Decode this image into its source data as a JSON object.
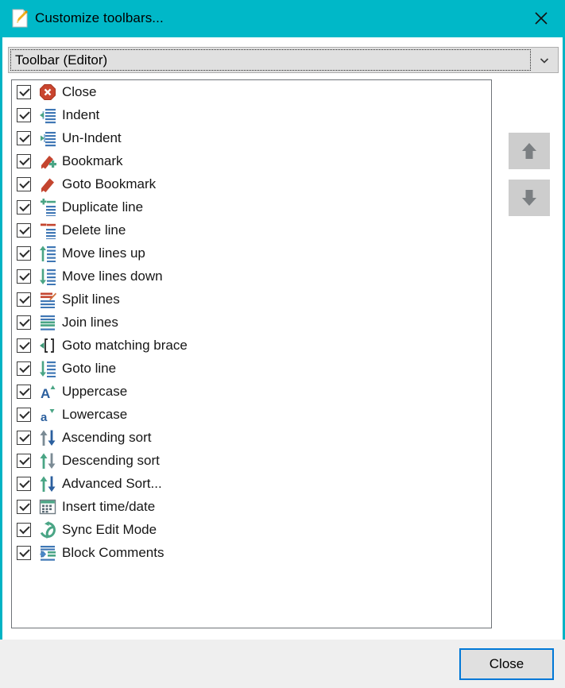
{
  "window": {
    "accent_color": "#00b8c8",
    "border_color": "#00b3c4",
    "title": "Customize toolbars...",
    "title_icon": "note-pencil-icon",
    "close_icon": "close-x-icon"
  },
  "combobox": {
    "name": "toolbar-selector",
    "value": "Toolbar (Editor)",
    "placeholder": "Toolbar (Editor)",
    "arrow_icon": "chevron-down-icon",
    "options": [
      "Toolbar (Editor)"
    ]
  },
  "list": {
    "items": [
      {
        "label": "Close",
        "checked": true,
        "icon": "stop-close-icon"
      },
      {
        "label": "Indent",
        "checked": true,
        "icon": "indent-icon"
      },
      {
        "label": "Un-Indent",
        "checked": true,
        "icon": "unindent-icon"
      },
      {
        "label": "Bookmark",
        "checked": true,
        "icon": "bookmark-add-icon"
      },
      {
        "label": "Goto Bookmark",
        "checked": true,
        "icon": "bookmark-icon"
      },
      {
        "label": "Duplicate line",
        "checked": true,
        "icon": "duplicate-line-icon"
      },
      {
        "label": "Delete line",
        "checked": true,
        "icon": "delete-line-icon"
      },
      {
        "label": "Move lines up",
        "checked": true,
        "icon": "move-lines-up-icon"
      },
      {
        "label": "Move lines down",
        "checked": true,
        "icon": "move-lines-down-icon"
      },
      {
        "label": "Split lines",
        "checked": true,
        "icon": "split-lines-icon"
      },
      {
        "label": "Join lines",
        "checked": true,
        "icon": "join-lines-icon"
      },
      {
        "label": "Goto matching brace",
        "checked": true,
        "icon": "matching-brace-icon"
      },
      {
        "label": "Goto line",
        "checked": true,
        "icon": "goto-line-icon"
      },
      {
        "label": "Uppercase",
        "checked": true,
        "icon": "uppercase-icon"
      },
      {
        "label": "Lowercase",
        "checked": true,
        "icon": "lowercase-icon"
      },
      {
        "label": "Ascending sort",
        "checked": true,
        "icon": "ascending-sort-icon"
      },
      {
        "label": "Descending sort",
        "checked": true,
        "icon": "descending-sort-icon"
      },
      {
        "label": "Advanced Sort...",
        "checked": true,
        "icon": "advanced-sort-icon"
      },
      {
        "label": "Insert time/date",
        "checked": true,
        "icon": "calendar-icon"
      },
      {
        "label": "Sync Edit Mode",
        "checked": true,
        "icon": "sync-edit-icon"
      },
      {
        "label": "Block Comments",
        "checked": true,
        "icon": "block-comments-icon"
      }
    ]
  },
  "reorder": {
    "up_icon": "arrow-up-icon",
    "down_icon": "arrow-down-icon"
  },
  "footer": {
    "close_label": "Close",
    "focus_color": "#0078d7"
  }
}
